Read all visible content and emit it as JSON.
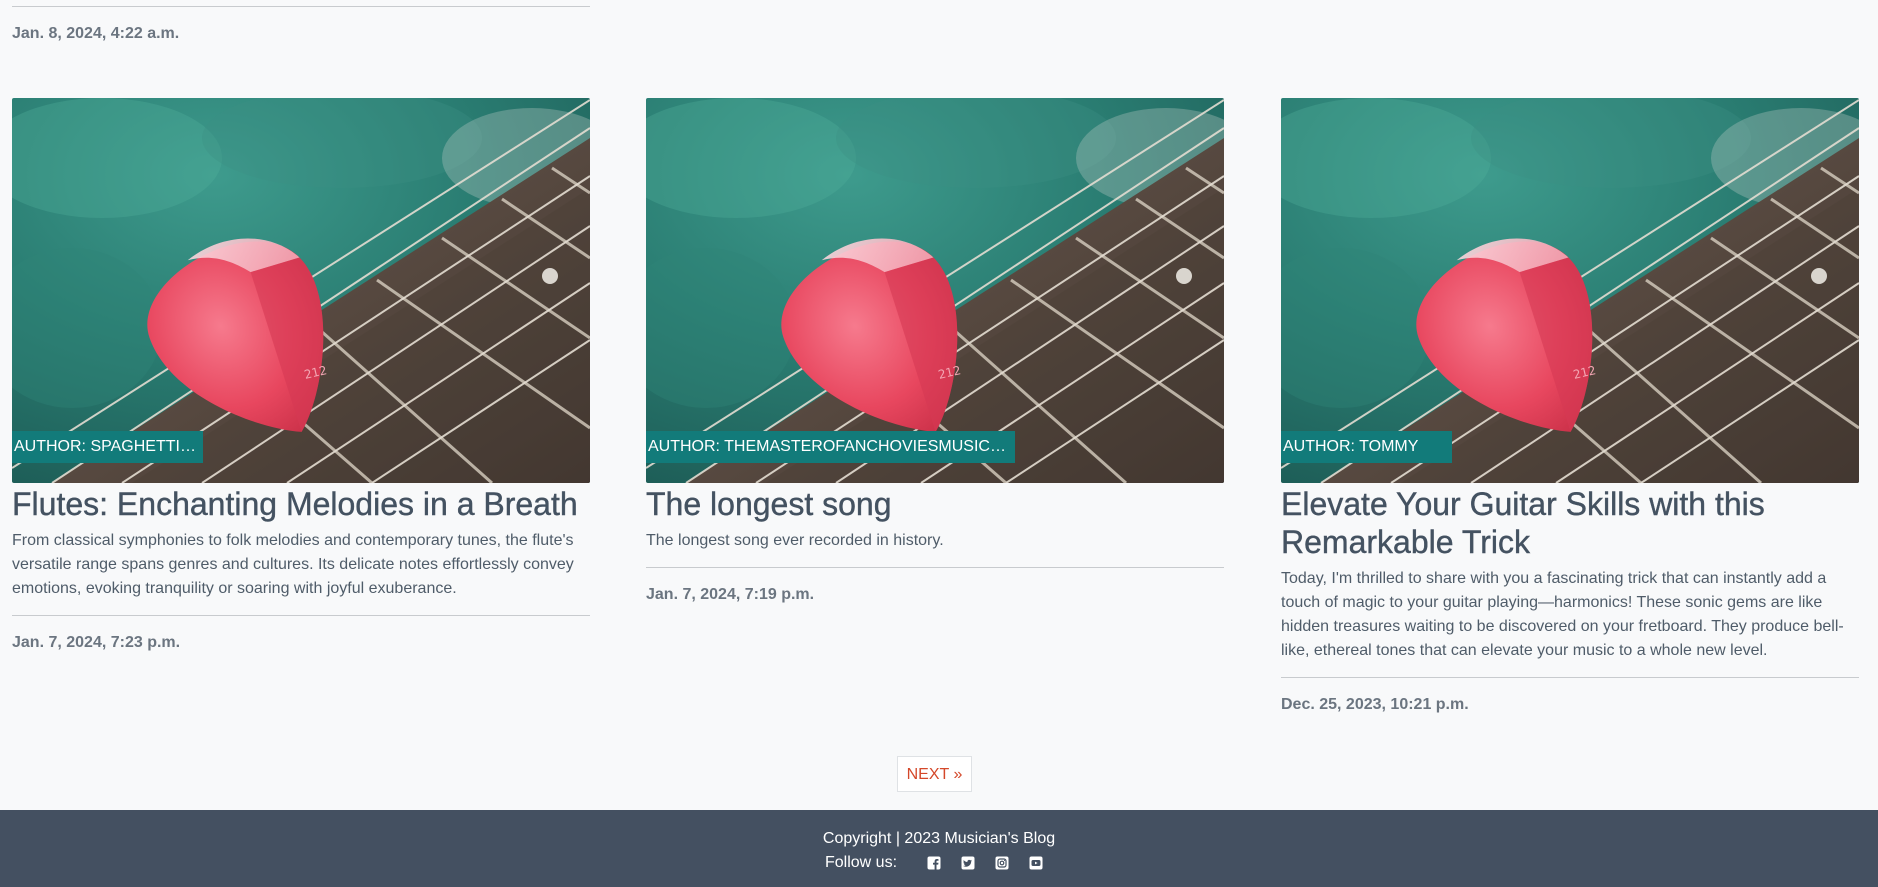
{
  "top_post": {
    "date": "Jan. 8, 2024, 4:22 a.m."
  },
  "posts": [
    {
      "author": "AUTHOR: SPAGHETTIMAN",
      "title": "Flutes: Enchanting Melodies in a Breath",
      "excerpt": "From classical symphonies to folk melodies and contemporary tunes, the flute's versatile range spans genres and cultures. Its delicate notes effortlessly convey emotions, evoking tranquility or soaring with joyful exuberance.",
      "date": "Jan. 7, 2024, 7:23 p.m.",
      "image": "guitar-pick-on-strings"
    },
    {
      "author": "AUTHOR: THEMASTEROFANCHOVIESMUSICANDE...",
      "title": "The longest song",
      "excerpt": "The longest song ever recorded in history.",
      "date": "Jan. 7, 2024, 7:19 p.m.",
      "image": "guitar-pick-on-strings"
    },
    {
      "author": "AUTHOR: TOMMY",
      "title": "Elevate Your Guitar Skills with this Remarkable Trick",
      "excerpt": "Today, I'm thrilled to share with you a fascinating trick that can instantly add a touch of magic to your guitar playing—harmonics! These sonic gems are like hidden treasures waiting to be discovered on your fretboard. They produce bell-like, ethereal tones that can elevate your music to a whole new level.",
      "date": "Dec. 25, 2023, 10:21 p.m.",
      "image": "guitar-pick-on-strings"
    }
  ],
  "pagination": {
    "next_label": "NEXT »"
  },
  "footer": {
    "copyright": "Copyright | 2023 Musician's Blog",
    "follow_label": "Follow us:",
    "social_icons": [
      "facebook-icon",
      "twitter-icon",
      "instagram-icon",
      "youtube-icon"
    ]
  },
  "colors": {
    "author_badge": "#127b7a",
    "footer_bg": "#445061",
    "next_link": "#d4482a",
    "page_bg": "#f8f9fa"
  }
}
